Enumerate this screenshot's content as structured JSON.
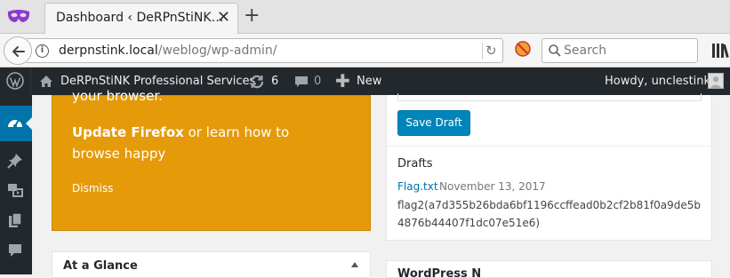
{
  "browser": {
    "tab_title": "Dashboard ‹ DeRPnStiNK…",
    "tab_close": "✕",
    "new_tab": "+",
    "url_host": "derpnstink.local",
    "url_path": "/weblog/wp-admin/",
    "search_placeholder": "Search"
  },
  "adminbar": {
    "site_name": "DeRPnStiNK Professional Services",
    "updates_count": "6",
    "comments_count": "0",
    "new_label": "New",
    "howdy": "Howdy, unclestinky"
  },
  "notice": {
    "top_text": "your browser.",
    "update_label": "Update Firefox",
    "rest_text": " or learn how to browse happy",
    "dismiss_label": "Dismiss",
    "bg_color": "#e59a09"
  },
  "glance": {
    "title": "At a Glance"
  },
  "quick_draft": {
    "save_label": "Save Draft",
    "drafts_heading": "Drafts",
    "draft_title": "Flag.txt",
    "draft_date": "November 13, 2017",
    "draft_excerpt": "flag2(a7d355b26bda6bf1196ccffead0b2cf2b81f0a9de5b4876b44407f1dc07e51e6)"
  },
  "news": {
    "title": "WordPress N"
  },
  "colors": {
    "admin_bar": "#23282d",
    "primary_button": "#0085ba",
    "link": "#0073aa"
  }
}
